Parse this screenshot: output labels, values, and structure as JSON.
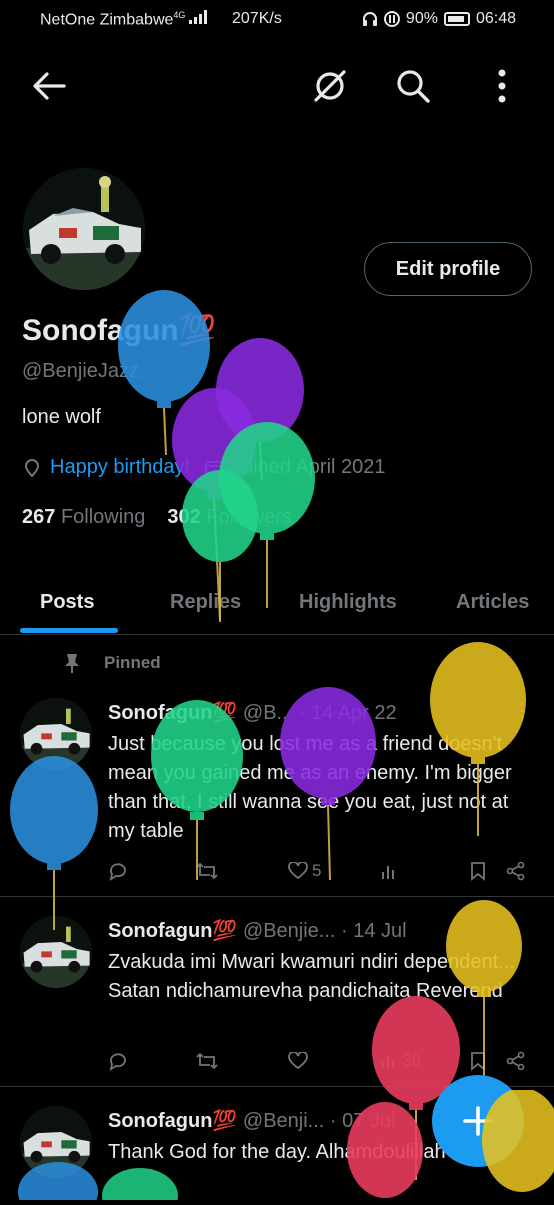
{
  "status_bar": {
    "carrier": "NetOne Zimbabwe",
    "network": "4G",
    "speed": "207K/s",
    "battery": "90%",
    "time": "06:48"
  },
  "profile": {
    "name": "Sonofagun💯",
    "handle": "@BenjieJazz",
    "bio": "lone wolf",
    "birthday": "Happy birthday!",
    "joined": "Joined April 2021",
    "following_count": "267",
    "following_label": "Following",
    "followers_count": "302",
    "followers_label": "Followers",
    "edit_label": "Edit profile"
  },
  "tabs": [
    "Posts",
    "Replies",
    "Highlights",
    "Articles"
  ],
  "pinned_label": "Pinned",
  "posts": [
    {
      "name": "Sonofagun💯",
      "handle": "@B...",
      "date": "· 14 Apr 22",
      "text": "Just because you lost me as a friend doesn't mean you gained me as an enemy. I'm bigger than that, I still wanna see you eat, just not at my table",
      "likes": "5",
      "views": ""
    },
    {
      "name": "Sonofagun💯",
      "handle": "@Benjie...",
      "date": "· 14 Jul",
      "text": "Zvakuda imi Mwari kwamuri ndiri dependent... Satan ndichamurevha pandichaita Reverend",
      "likes": "",
      "views": "36"
    },
    {
      "name": "Sonofagun💯",
      "handle": "@Benji...",
      "date": "· 07 Jul",
      "text": "Thank God for the day. Alhamdoulillah 🙏🏾",
      "likes": "",
      "views": ""
    }
  ],
  "colors": {
    "accent": "#1d9bf0",
    "balloon_blue": "#2b8fe0",
    "balloon_purple": "#8a2be2",
    "balloon_green": "#21d48a",
    "balloon_gold": "#e6c21f",
    "balloon_red": "#e83c5e"
  },
  "icons": {
    "back": "arrow-left-icon",
    "grok": "grok-icon",
    "search": "search-icon",
    "more": "more-vertical-icon",
    "compose": "plus-icon"
  }
}
